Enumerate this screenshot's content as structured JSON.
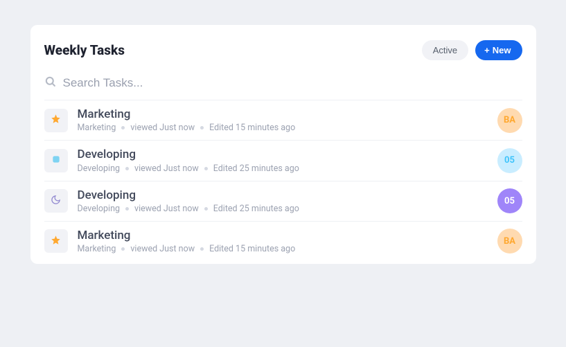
{
  "header": {
    "title": "Weekly Tasks",
    "active_label": "Active",
    "new_label": "New"
  },
  "search": {
    "placeholder": "Search Tasks..."
  },
  "tasks": [
    {
      "title": "Marketing",
      "category": "Marketing",
      "viewed": "viewed Just now",
      "edited": "Edited 15 minutes ago",
      "icon": "star",
      "avatar_text": "BA",
      "avatar_style": "peach"
    },
    {
      "title": "Developing",
      "category": "Developing",
      "viewed": "viewed Just now",
      "edited": "Edited 25 minutes ago",
      "icon": "square",
      "avatar_text": "05",
      "avatar_style": "sky"
    },
    {
      "title": "Developing",
      "category": "Developing",
      "viewed": "viewed Just now",
      "edited": "Edited 25 minutes ago",
      "icon": "moon",
      "avatar_text": "05",
      "avatar_style": "violet"
    },
    {
      "title": "Marketing",
      "category": "Marketing",
      "viewed": "viewed Just now",
      "edited": "Edited 15 minutes ago",
      "icon": "star",
      "avatar_text": "BA",
      "avatar_style": "peach"
    }
  ]
}
